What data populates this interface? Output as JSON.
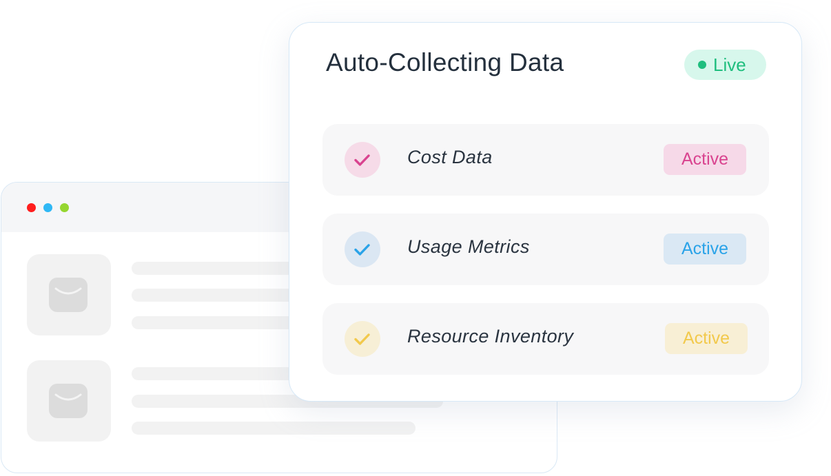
{
  "card": {
    "title": "Auto-Collecting Data",
    "live_badge": {
      "label": "Live",
      "color": "#1fbe7e",
      "background": "#d7f7ec"
    },
    "items": [
      {
        "label": "Cost Data",
        "icon": "check-icon",
        "status": "Active",
        "accent": "#d9438f",
        "icon_background": "#f6dbe8",
        "badge_background": "#f6d9e8"
      },
      {
        "label": "Usage Metrics",
        "icon": "check-icon",
        "status": "Active",
        "accent": "#2aa3e8",
        "icon_background": "#dbe7f3",
        "badge_background": "#dae8f4"
      },
      {
        "label": "Resource Inventory",
        "icon": "check-icon",
        "status": "Active",
        "accent": "#f2c94c",
        "icon_background": "#f7efd6",
        "badge_background": "#f8efd5"
      }
    ]
  },
  "background_window": {
    "traffic_lights": [
      "#ff1e1e",
      "#2fb8f5",
      "#95d630"
    ],
    "rows": [
      {
        "icon": "envelope-icon"
      },
      {
        "icon": "envelope-icon"
      }
    ]
  }
}
